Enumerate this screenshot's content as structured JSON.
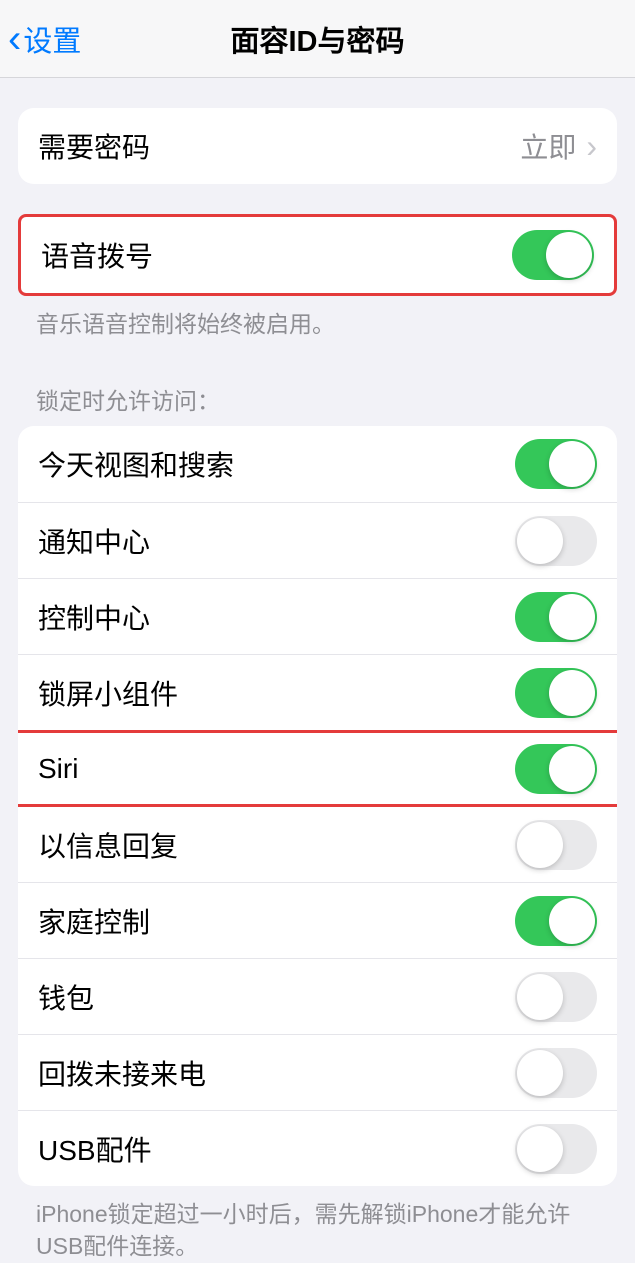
{
  "nav": {
    "back_label": "设置",
    "title": "面容ID与密码"
  },
  "passcode_group": {
    "require_passcode": {
      "label": "需要密码",
      "value": "立即"
    }
  },
  "voice_group": {
    "voice_dial": {
      "label": "语音拨号",
      "on": true
    },
    "footer": "音乐语音控制将始终被启用。"
  },
  "lock_access": {
    "header": "锁定时允许访问：",
    "items": [
      {
        "key": "today",
        "label": "今天视图和搜索",
        "on": true,
        "highlight": false
      },
      {
        "key": "notification_center",
        "label": "通知中心",
        "on": false,
        "highlight": false
      },
      {
        "key": "control_center",
        "label": "控制中心",
        "on": true,
        "highlight": false
      },
      {
        "key": "lock_widgets",
        "label": "锁屏小组件",
        "on": true,
        "highlight": false
      },
      {
        "key": "siri",
        "label": "Siri",
        "on": true,
        "highlight": true
      },
      {
        "key": "reply_msg",
        "label": "以信息回复",
        "on": false,
        "highlight": false
      },
      {
        "key": "home_control",
        "label": "家庭控制",
        "on": true,
        "highlight": false
      },
      {
        "key": "wallet",
        "label": "钱包",
        "on": false,
        "highlight": false
      },
      {
        "key": "return_missed",
        "label": "回拨未接来电",
        "on": false,
        "highlight": false
      },
      {
        "key": "usb_accessories",
        "label": "USB配件",
        "on": false,
        "highlight": false
      }
    ],
    "footer": "iPhone锁定超过一小时后，需先解锁iPhone才能允许USB配件连接。"
  }
}
